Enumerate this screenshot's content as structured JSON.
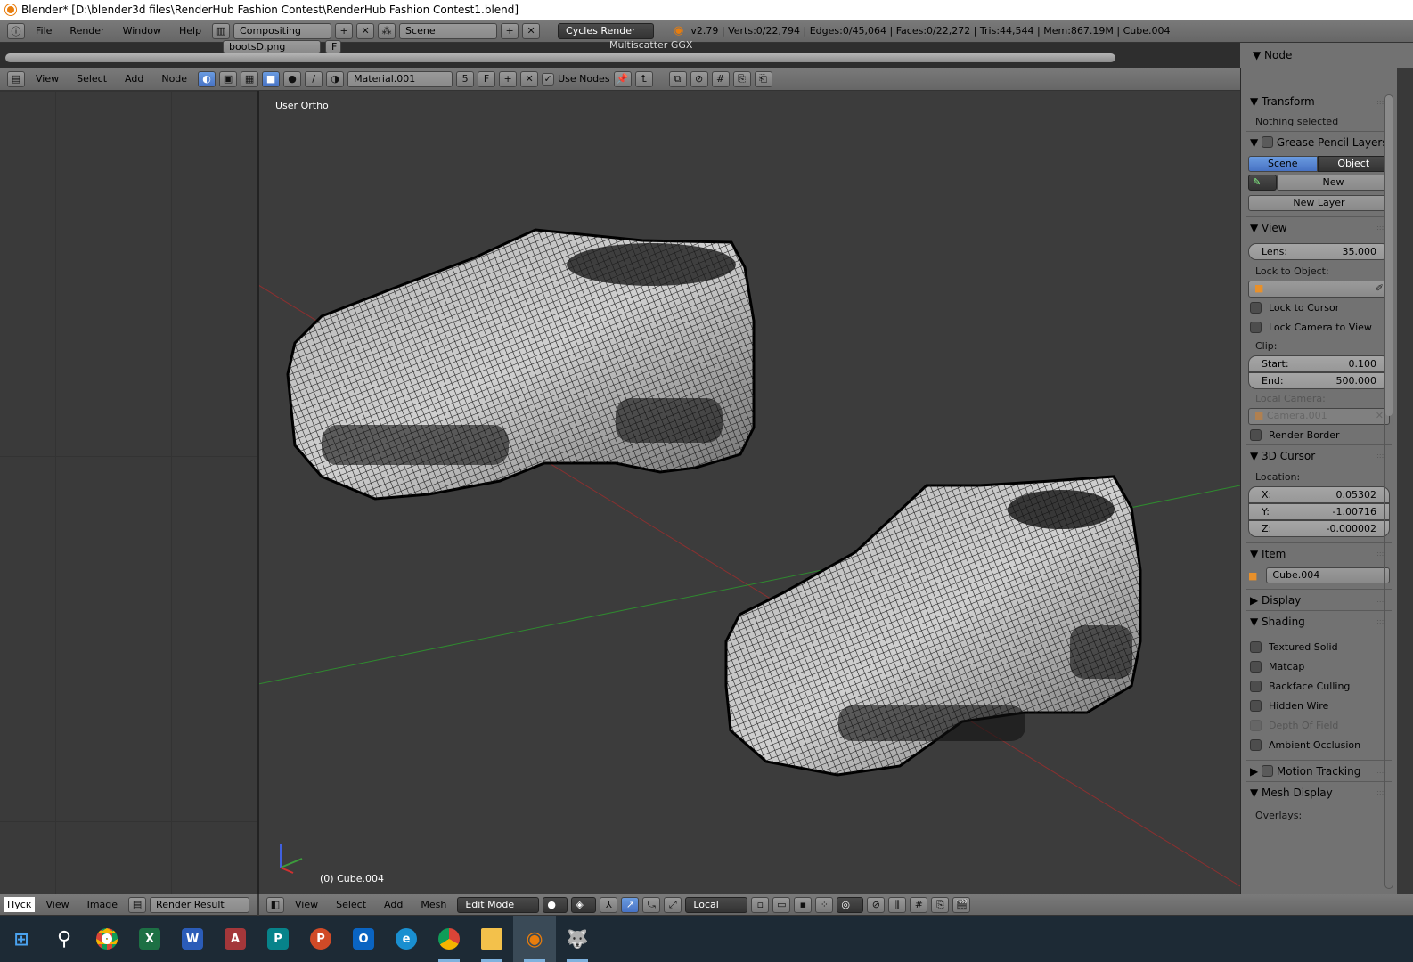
{
  "window": {
    "title": "Blender* [D:\\blender3d files\\RenderHub Fashion Contest\\RenderHub Fashion Contest1.blend]"
  },
  "info_header": {
    "menus": [
      "File",
      "Render",
      "Window",
      "Help"
    ],
    "layout": "Compositing",
    "scene": "Scene",
    "engine": "Cycles Render",
    "stats": "v2.79 | Verts:0/22,794 | Edges:0/45,064 | Faces:0/22,272 | Tris:44,544 | Mem:867.19M | Cube.004"
  },
  "image_strip": {
    "image": "bootsD.png",
    "fake": "F",
    "node_label": "Multiscatter GGX"
  },
  "node_header": {
    "menus": [
      "View",
      "Select",
      "Add",
      "Node"
    ],
    "material": "Material.001",
    "users": "5",
    "fake": "F",
    "use_nodes": "Use Nodes",
    "use_nodes_checked": true
  },
  "node_panel": {
    "title": "Node"
  },
  "viewport": {
    "view_label": "User Ortho",
    "object_label": "(0) Cube.004",
    "axis_colors": {
      "x": "#b33636",
      "y": "#3c9b3c"
    }
  },
  "properties": {
    "transform": {
      "title": "Transform",
      "text": "Nothing selected"
    },
    "grease_pencil": {
      "title": "Grease Pencil Layers",
      "tabs": [
        "Scene",
        "Object"
      ],
      "active_tab": "Scene",
      "new": "New",
      "new_layer": "New Layer"
    },
    "view": {
      "title": "View",
      "lens_label": "Lens:",
      "lens": "35.000",
      "lock_to_object": "Lock to Object:",
      "lock_to_cursor": "Lock to Cursor",
      "lock_camera": "Lock Camera to View",
      "clip": "Clip:",
      "start_label": "Start:",
      "start": "0.100",
      "end_label": "End:",
      "end": "500.000",
      "local_camera": "Local Camera:",
      "camera": "Camera.001",
      "render_border": "Render Border"
    },
    "cursor": {
      "title": "3D Cursor",
      "location": "Location:",
      "x_label": "X:",
      "x": "0.05302",
      "y_label": "Y:",
      "y": "-1.00716",
      "z_label": "Z:",
      "z": "-0.000002"
    },
    "item": {
      "title": "Item",
      "name": "Cube.004"
    },
    "display": {
      "title": "Display"
    },
    "shading": {
      "title": "Shading",
      "options": [
        "Textured Solid",
        "Matcap",
        "Backface Culling",
        "Hidden Wire",
        "Depth Of Field",
        "Ambient Occlusion"
      ]
    },
    "motion_tracking": {
      "title": "Motion Tracking"
    },
    "mesh_display": {
      "title": "Mesh Display",
      "overlays": "Overlays:"
    }
  },
  "bottom_left": {
    "start": "Пуск",
    "menus": [
      "View",
      "Image"
    ],
    "image": "Render Result"
  },
  "bottom_3d": {
    "menus": [
      "View",
      "Select",
      "Add",
      "Mesh"
    ],
    "mode": "Edit Mode",
    "orientation": "Local"
  },
  "taskbar": {
    "apps": [
      "windows",
      "search",
      "chrome",
      "excel",
      "word",
      "access",
      "publisher",
      "powerpoint",
      "outlook",
      "edge",
      "chrome-profile",
      "explorer",
      "blender",
      "gimp"
    ]
  }
}
